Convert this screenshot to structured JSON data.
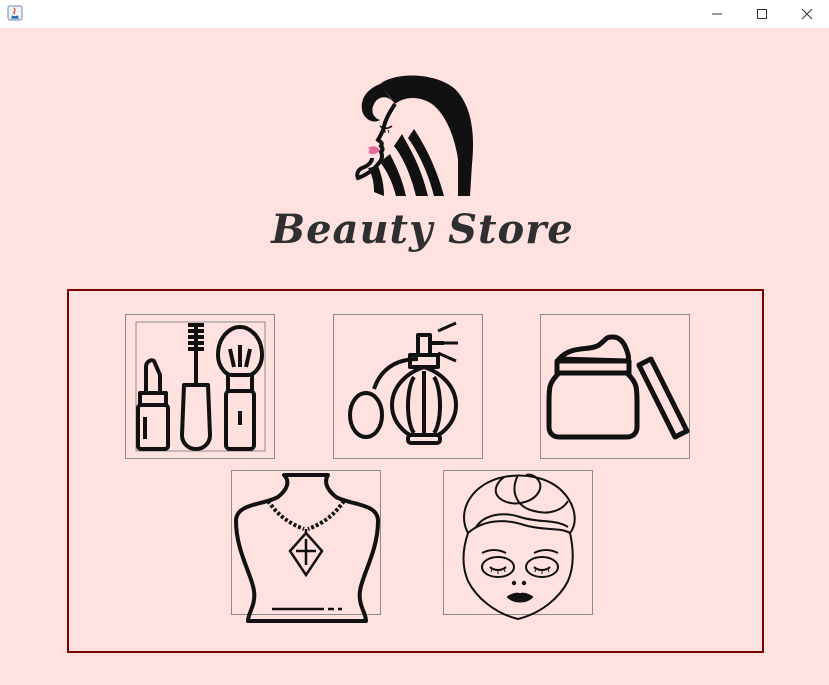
{
  "window": {
    "app_icon": "java-app-icon",
    "controls": {
      "minimize_icon": "minimize-icon",
      "maximize_icon": "maximize-icon",
      "close_icon": "close-icon"
    }
  },
  "brand": {
    "title": "Beauty Store",
    "logo_icon": "woman-profile-logo",
    "colors": {
      "background": "#ffe1df",
      "border": "#7a0000",
      "lips": "#e46a9b"
    }
  },
  "categories": [
    {
      "id": "makeup",
      "icon": "makeup-icon"
    },
    {
      "id": "perfume",
      "icon": "perfume-icon"
    },
    {
      "id": "cream",
      "icon": "cream-jar-icon"
    },
    {
      "id": "jewelry",
      "icon": "necklace-icon"
    },
    {
      "id": "skincare",
      "icon": "face-mask-icon"
    }
  ]
}
